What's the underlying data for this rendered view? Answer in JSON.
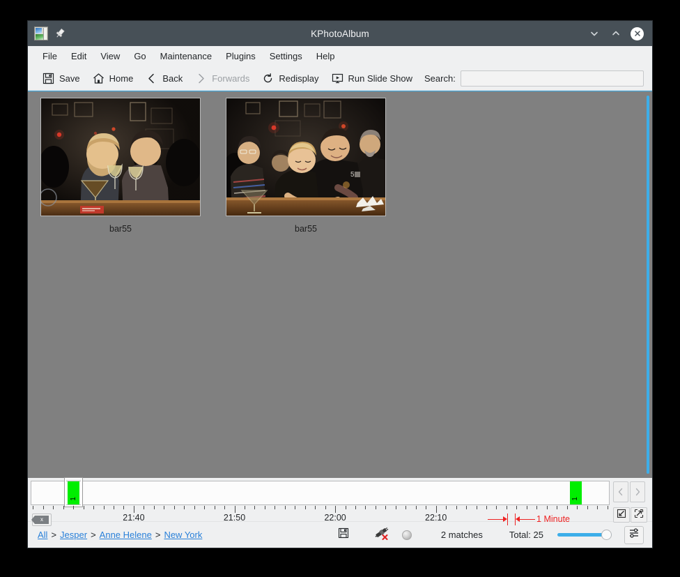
{
  "window": {
    "title": "KPhotoAlbum",
    "app_icon": "photo-album-icon",
    "pin_icon": "pin-icon",
    "minimize_icon": "chevron-down-icon",
    "maximize_icon": "chevron-up-icon",
    "close_icon": "close-icon"
  },
  "menubar": {
    "items": [
      {
        "label": "File"
      },
      {
        "label": "Edit"
      },
      {
        "label": "View"
      },
      {
        "label": "Go"
      },
      {
        "label": "Maintenance"
      },
      {
        "label": "Plugins"
      },
      {
        "label": "Settings"
      },
      {
        "label": "Help"
      }
    ]
  },
  "toolbar": {
    "save_label": "Save",
    "home_label": "Home",
    "back_label": "Back",
    "forwards_label": "Forwards",
    "redisplay_label": "Redisplay",
    "slideshow_label": "Run Slide Show",
    "search_label": "Search:",
    "search_value": "",
    "search_placeholder": ""
  },
  "thumbnails": [
    {
      "label": "bar55"
    },
    {
      "label": "bar55"
    }
  ],
  "datebar": {
    "clear_label": "x",
    "time_labels": [
      {
        "text": "21:40",
        "x_pct": 17.8
      },
      {
        "text": "21:50",
        "x_pct": 35.2
      },
      {
        "text": "22:00",
        "x_pct": 52.6
      },
      {
        "text": "22:10",
        "x_pct": 70.0
      }
    ],
    "bars": [
      {
        "count": "1",
        "x_pct": 6.3,
        "height_pct": 100,
        "selected": true
      },
      {
        "count": "1",
        "x_pct": 93.2,
        "height_pct": 100,
        "selected": false
      }
    ],
    "resolution_label": "1 Minute",
    "prev_icon": "chevron-left-icon",
    "next_icon": "chevron-right-icon",
    "zoom_out_icon": "zoom-out-icon",
    "zoom_in_icon": "zoom-in-icon"
  },
  "statusbar": {
    "breadcrumb": [
      {
        "label": "All"
      },
      {
        "label": "Jesper"
      },
      {
        "label": "Anne Helene"
      },
      {
        "label": "New York"
      }
    ],
    "breadcrumb_separator": ">",
    "dirty_icon": "save-icon",
    "plugin_icon": "disconnected-plug-icon",
    "led_icon": "status-led-icon",
    "matches_text": "2 matches",
    "total_text": "Total: 25",
    "thumbnail_size_value": 95,
    "settings_icon": "sliders-icon"
  },
  "colors": {
    "titlebar": "#475057",
    "chrome": "#eff0f1",
    "view_background": "#808080",
    "accent": "#3daee9",
    "link": "#2980d9",
    "bar_green": "#00ee00",
    "annotation_red": "#ee2222"
  }
}
